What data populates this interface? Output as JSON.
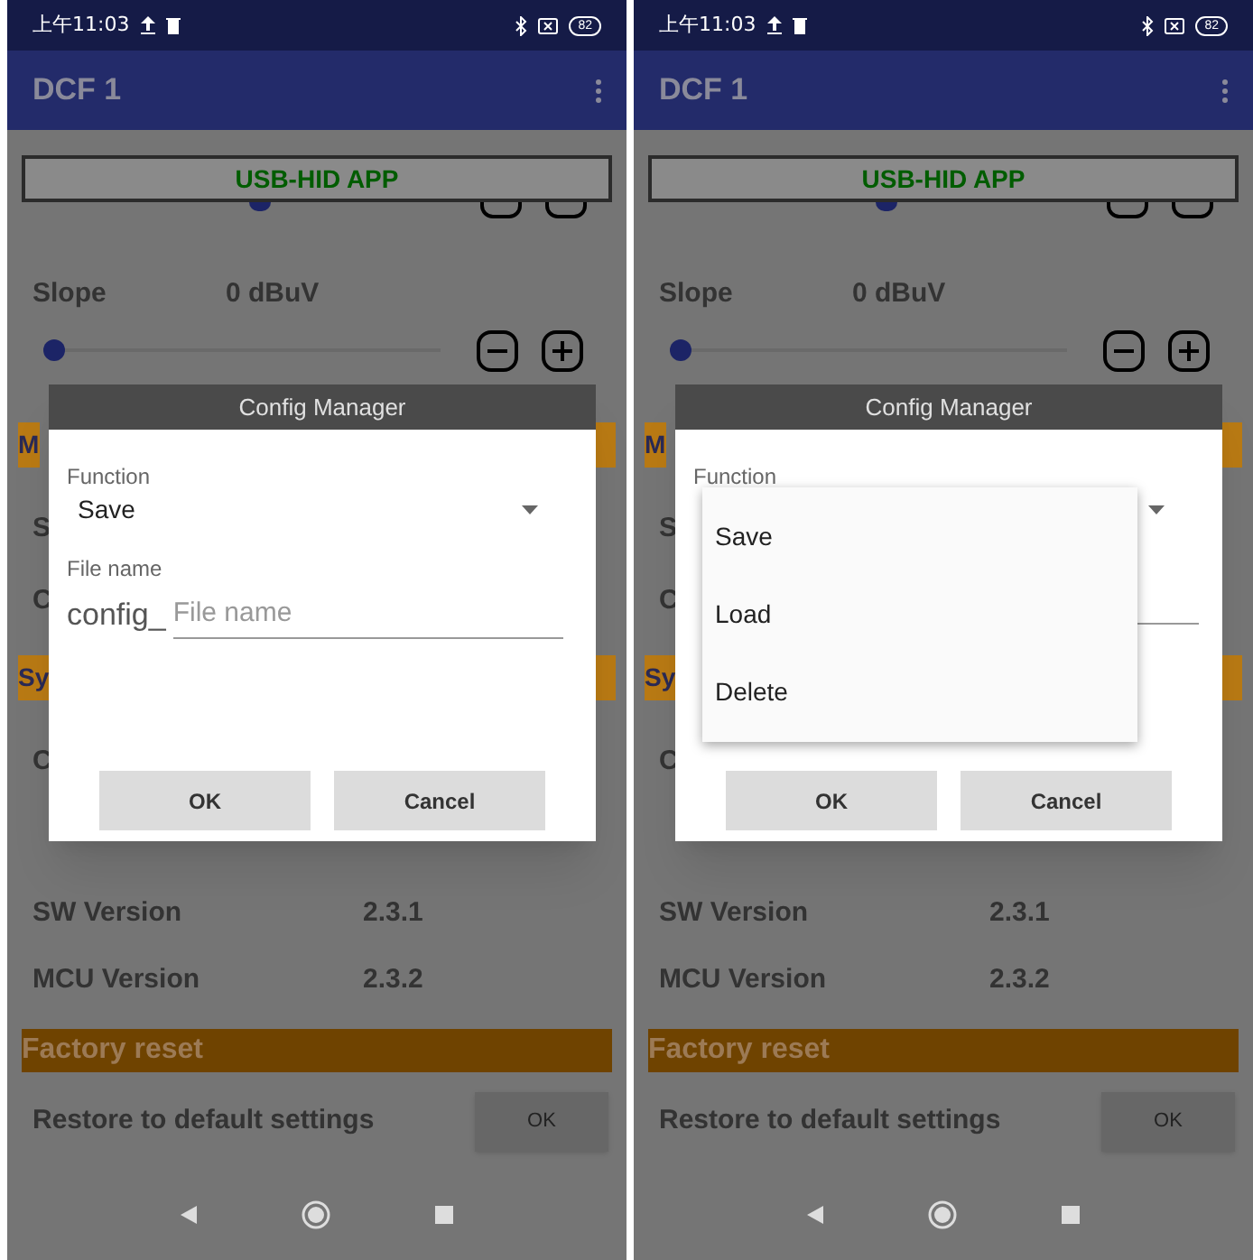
{
  "screens": [
    {
      "status_bar": {
        "time": "上午11:03",
        "battery": "82"
      },
      "app_bar": {
        "title": "DCF 1"
      },
      "banner": "USB-HID APP",
      "slope": {
        "label": "Slope",
        "reading": "0 dBuV",
        "level": 0
      },
      "covered_rows": [
        {
          "kind": "header",
          "text": "M"
        },
        {
          "kind": "row",
          "text": "S"
        },
        {
          "kind": "row",
          "text": "C"
        },
        {
          "kind": "header",
          "text": "Sy"
        },
        {
          "kind": "row",
          "text": "C"
        }
      ],
      "rows": [
        {
          "label": "SW Version",
          "value": "2.3.1"
        },
        {
          "label": "MCU Version",
          "value": "2.3.2"
        }
      ],
      "factory_reset": {
        "header": "Factory reset",
        "label": "Restore to default settings",
        "button": "OK"
      },
      "dialog": {
        "title": "Config Manager",
        "function_label": "Function",
        "function_value": "Save",
        "file_label": "File name",
        "prefix": "config_",
        "placeholder": "File name",
        "dropdown": {
          "expanded": false
        },
        "buttons": [
          "OK",
          "Cancel"
        ]
      }
    },
    {
      "status_bar": {
        "time": "上午11:03",
        "battery": "82"
      },
      "app_bar": {
        "title": "DCF 1"
      },
      "banner": "USB-HID APP",
      "slope": {
        "label": "Slope",
        "reading": "0 dBuV",
        "level": 0
      },
      "covered_rows": [
        {
          "kind": "header",
          "text": "M"
        },
        {
          "kind": "row",
          "text": "S"
        },
        {
          "kind": "row",
          "text": "C"
        },
        {
          "kind": "header",
          "text": "Sy"
        },
        {
          "kind": "row",
          "text": "C"
        }
      ],
      "rows": [
        {
          "label": "SW Version",
          "value": "2.3.1"
        },
        {
          "label": "MCU Version",
          "value": "2.3.2"
        }
      ],
      "factory_reset": {
        "header": "Factory reset",
        "label": "Restore to default settings",
        "button": "OK"
      },
      "dialog": {
        "title": "Config Manager",
        "function_label": "Function",
        "dropdown": {
          "expanded": true,
          "options": [
            "Save",
            "Load",
            "Delete"
          ]
        },
        "buttons": [
          "OK",
          "Cancel"
        ]
      }
    }
  ]
}
